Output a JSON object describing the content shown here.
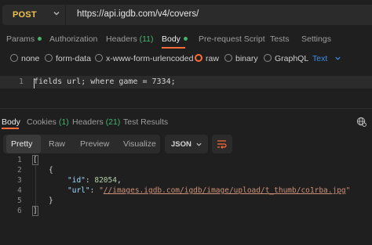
{
  "request": {
    "method": "POST",
    "url": "https://api.igdb.com/v4/covers/"
  },
  "request_tabs": [
    {
      "label": "Params",
      "indicator": "green-dot"
    },
    {
      "label": "Authorization"
    },
    {
      "label": "Headers",
      "count": "(11)"
    },
    {
      "label": "Body",
      "indicator": "green-dot",
      "active": true
    },
    {
      "label": "Pre-request Script"
    },
    {
      "label": "Tests"
    },
    {
      "label": "Settings"
    }
  ],
  "body_types": {
    "options": [
      "none",
      "form-data",
      "x-www-form-urlencoded",
      "raw",
      "binary",
      "GraphQL"
    ],
    "selected": "raw",
    "format": "Text"
  },
  "editor": {
    "lines": [
      {
        "num": "1",
        "text": "fields url; where game = 7334;"
      }
    ]
  },
  "response_tabs": [
    {
      "label": "Body",
      "active": true
    },
    {
      "label": "Cookies",
      "count": "(1)"
    },
    {
      "label": "Headers",
      "count": "(21)"
    },
    {
      "label": "Test Results"
    }
  ],
  "view_modes": [
    "Pretty",
    "Raw",
    "Preview",
    "Visualize"
  ],
  "active_view": "Pretty",
  "response_format": "JSON",
  "response_body": {
    "line_numbers": [
      "1",
      "2",
      "3",
      "4",
      "5",
      "6"
    ],
    "open_bracket": "[",
    "open_brace": "{",
    "id_key": "\"id\"",
    "id_value": "82054",
    "url_key": "\"url\"",
    "url_open_quote": "\"",
    "url_value": "//images.igdb.com/igdb/image/upload/t_thumb/co1rba.jpg",
    "url_close_quote": "\"",
    "close_brace": "}",
    "close_bracket": "]"
  },
  "colors": {
    "accent": "#ff6c37",
    "method": "#f0c34d",
    "indicator": "#45b36b",
    "link": "#3b8eea"
  }
}
